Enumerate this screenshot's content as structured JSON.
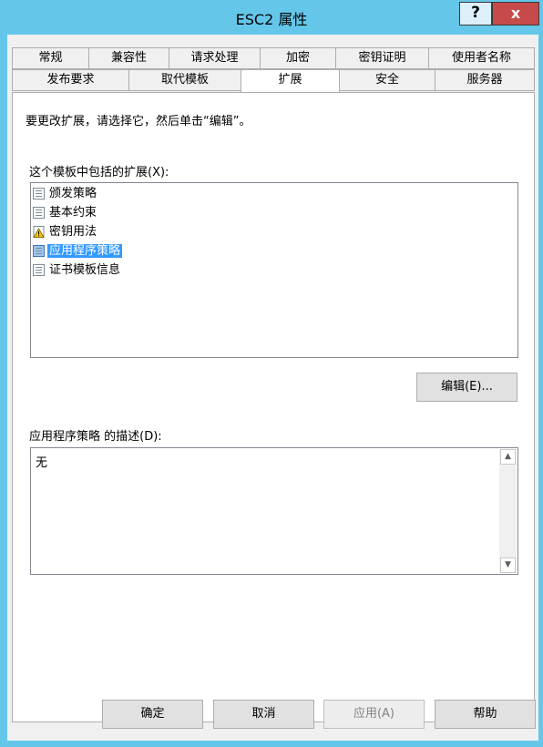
{
  "window": {
    "title": "ESC2 属性",
    "help_label": "?",
    "close_label": "x"
  },
  "tabs": {
    "row1": [
      "常规",
      "兼容性",
      "请求处理",
      "加密",
      "密钥证明",
      "使用者名称"
    ],
    "row2": [
      "发布要求",
      "取代模板",
      "扩展",
      "安全",
      "服务器"
    ],
    "active": "扩展"
  },
  "extensions_page": {
    "instruction": "要更改扩展，请选择它，然后单击“编辑”。",
    "list_label": "这个模板中包括的扩展(X):",
    "items": [
      {
        "label": "颁发策略",
        "icon": "page-icon"
      },
      {
        "label": "基本约束",
        "icon": "page-icon"
      },
      {
        "label": "密钥用法",
        "icon": "warning-page-icon"
      },
      {
        "label": "应用程序策略",
        "icon": "page-icon",
        "selected": true
      },
      {
        "label": "证书模板信息",
        "icon": "page-icon"
      }
    ],
    "edit_button": "编辑(E)...",
    "description_label": "应用程序策略 的描述(D):",
    "description_text": "无"
  },
  "footer": {
    "ok": "确定",
    "cancel": "取消",
    "apply": "应用(A)",
    "help": "帮助"
  },
  "colors": {
    "titlebar": "#64c7ea",
    "close_button": "#c74a4a",
    "selection": "#3399ff"
  }
}
